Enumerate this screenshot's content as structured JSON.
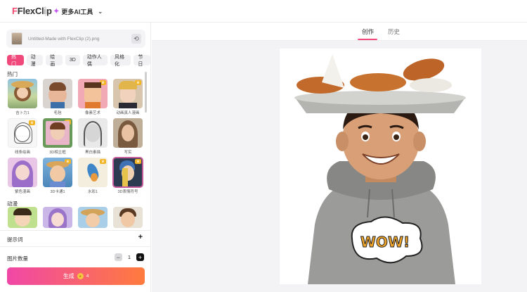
{
  "app": {
    "logo": {
      "part1": "Flex",
      "part2": "Clip"
    },
    "more_ai": "更多AI工具"
  },
  "left_panel": {
    "file_name": "Untitled-Made with FlexClip (2).png",
    "categories": [
      {
        "label": "热门",
        "active": true
      },
      {
        "label": "动漫",
        "active": false
      },
      {
        "label": "绘画",
        "active": false
      },
      {
        "label": "3D",
        "active": false
      },
      {
        "label": "动作人偶",
        "active": false
      },
      {
        "label": "风格化",
        "active": false
      },
      {
        "label": "节日",
        "active": false
      }
    ],
    "section_hot": "热门",
    "section_anime": "动漫",
    "hot_styles": [
      {
        "label": "吉卜力1",
        "premium": false
      },
      {
        "label": "毛毡",
        "premium": false
      },
      {
        "label": "像素艺术",
        "premium": true
      },
      {
        "label": "动画真人漫画",
        "premium": true
      },
      {
        "label": "线条绘画",
        "premium": true
      },
      {
        "label": "3D相立框",
        "premium": true
      },
      {
        "label": "黑白素描",
        "premium": false
      },
      {
        "label": "写实",
        "premium": false
      },
      {
        "label": "紫色漫画",
        "premium": false
      },
      {
        "label": "3D卡通1",
        "premium": true
      },
      {
        "label": "水彩1",
        "premium": true
      },
      {
        "label": "3D表情符号",
        "premium": true,
        "selected": true
      }
    ],
    "prompt_label": "提示词",
    "image_count_label": "图片数量",
    "image_count": "1",
    "generate_label": "生成",
    "generate_cost": "4"
  },
  "right_panel": {
    "tabs": [
      {
        "label": "创作",
        "active": true
      },
      {
        "label": "历史",
        "active": false
      }
    ]
  },
  "colors": {
    "accent": "#f0487a",
    "gradient_start": "#f047a7",
    "gradient_end": "#ff7b3d"
  }
}
